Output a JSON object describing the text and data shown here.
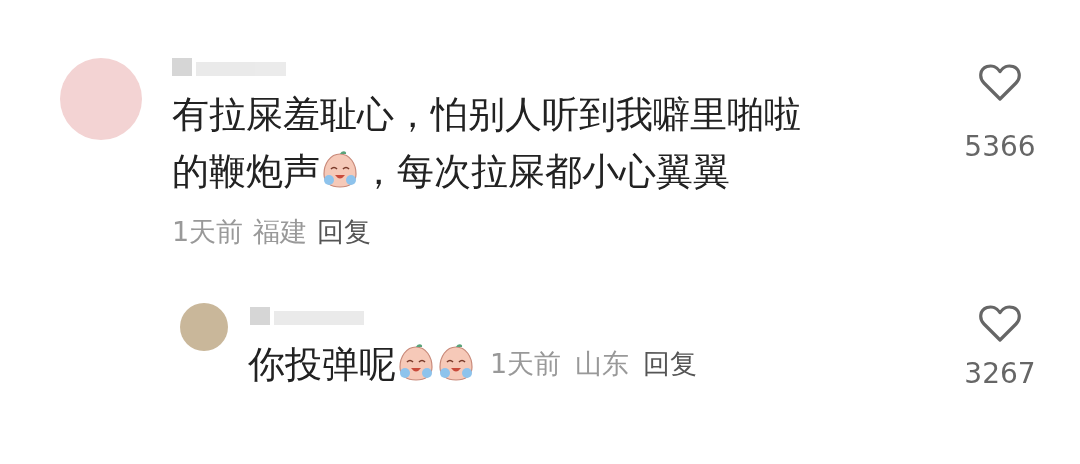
{
  "comments": [
    {
      "content": [
        {
          "kind": "text",
          "text": "有拉屎羞耻心，怕别人听到我噼里啪啦的鞭炮声"
        },
        {
          "kind": "emoji"
        },
        {
          "kind": "text",
          "text": "，每次拉屎都小心翼翼"
        }
      ],
      "time": "1天前",
      "location": "福建",
      "reply": "回复",
      "likes": "5366",
      "liked": false
    },
    {
      "content": [
        {
          "kind": "text",
          "text": "你投弹呢"
        },
        {
          "kind": "emoji"
        },
        {
          "kind": "emoji"
        }
      ],
      "time": "1天前",
      "location": "山东",
      "reply": "回复",
      "likes": "3267",
      "liked": false
    }
  ]
}
